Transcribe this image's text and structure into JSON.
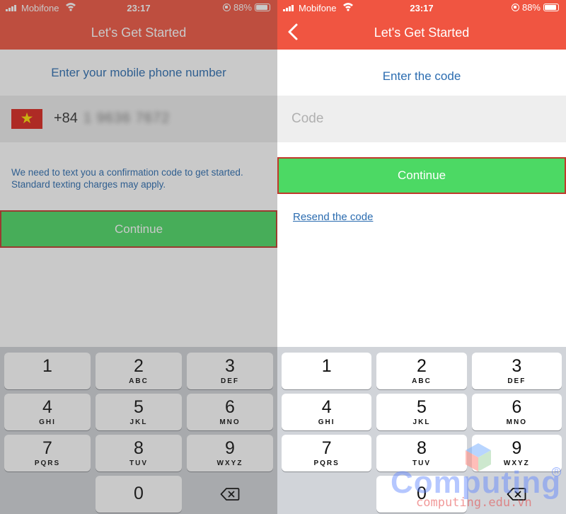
{
  "status_bar": {
    "carrier": "Mobifone",
    "time": "23:17",
    "battery": "88%"
  },
  "colors": {
    "header": "#f05541",
    "continue": "#4cd964",
    "link_text": "#2b6cb0",
    "highlight_border": "#c0392b"
  },
  "left_screen": {
    "title": "Let's Get Started",
    "prompt": "Enter your mobile phone number",
    "country_flag": "vietnam-flag",
    "country_code": "+84",
    "phone_number_masked": "1 9636 7672",
    "notice": "We need to text you a confirmation code to get started. Standard texting charges may apply.",
    "continue_label": "Continue"
  },
  "right_screen": {
    "title": "Let's Get Started",
    "back_icon": "chevron-left-icon",
    "prompt": "Enter the code",
    "code_placeholder": "Code",
    "code_value": "",
    "continue_label": "Continue",
    "resend_label": "Resend the code"
  },
  "keypad": {
    "keys": [
      {
        "digit": "1",
        "letters": ""
      },
      {
        "digit": "2",
        "letters": "ABC"
      },
      {
        "digit": "3",
        "letters": "DEF"
      },
      {
        "digit": "4",
        "letters": "GHI"
      },
      {
        "digit": "5",
        "letters": "JKL"
      },
      {
        "digit": "6",
        "letters": "MNO"
      },
      {
        "digit": "7",
        "letters": "PQRS"
      },
      {
        "digit": "8",
        "letters": "TUV"
      },
      {
        "digit": "9",
        "letters": "WXYZ"
      },
      {
        "digit": "0",
        "letters": ""
      }
    ],
    "delete_icon": "backspace-icon"
  },
  "watermark": {
    "brand": "Computing",
    "url": "computing.edu.vn"
  }
}
